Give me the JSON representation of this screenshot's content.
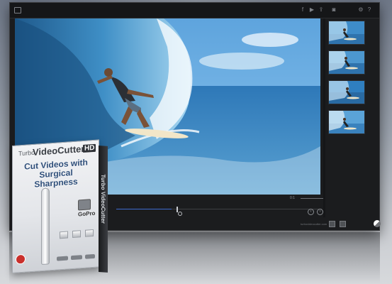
{
  "window": {
    "title_icons": [
      "facebook-icon",
      "youtube-icon",
      "share-icon",
      "camera-icon",
      "gear-icon",
      "help-icon"
    ],
    "help_glyph": "?"
  },
  "player": {
    "time_readout": "0:1",
    "nav_prev": "‹",
    "nav_next": "›",
    "footer_link": "turbovideocutter.com"
  },
  "product_box": {
    "brand_prefix": "Turbo",
    "brand_name": "VideoCutter",
    "hd_badge": "HD",
    "tagline_line1": "Cut Videos with",
    "tagline_line2": "Surgical Sharpness",
    "gopro_label": "GoPro",
    "side_text": "Turbo VideoCutter"
  },
  "colors": {
    "window_bg": "#1b1c1e",
    "scrub_progress": "#3e6bd0",
    "tagline": "#2f4f7a"
  }
}
